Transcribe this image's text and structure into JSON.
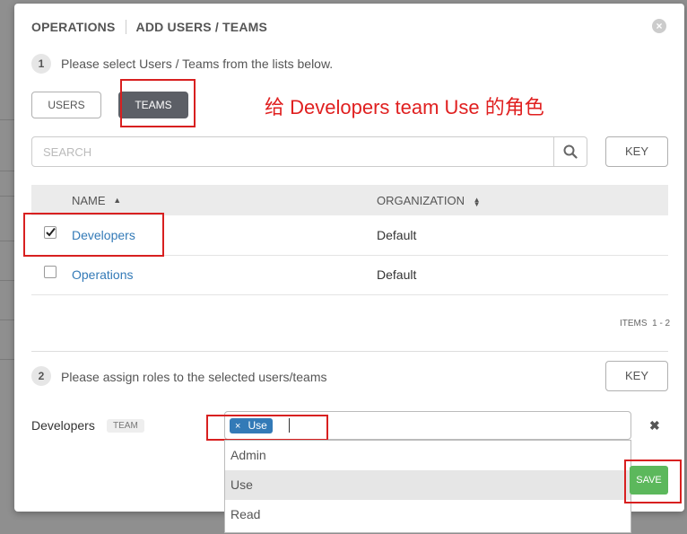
{
  "header": {
    "crumb1": "OPERATIONS",
    "crumb2": "ADD USERS / TEAMS",
    "close_icon": "close-circle-icon"
  },
  "step1": {
    "num": "1",
    "text": "Please select Users / Teams from the lists below."
  },
  "tabs": {
    "users": "USERS",
    "teams": "TEAMS",
    "active": "teams"
  },
  "annotation": "给 Developers team Use 的角色",
  "search": {
    "placeholder": "SEARCH",
    "key_label": "KEY",
    "icon": "search-icon"
  },
  "table": {
    "col_name": "NAME",
    "col_org": "ORGANIZATION",
    "rows": [
      {
        "name": "Developers",
        "org": "Default",
        "checked": true
      },
      {
        "name": "Operations",
        "org": "Default",
        "checked": false
      }
    ],
    "items_label": "ITEMS  1 - 2"
  },
  "step2": {
    "num": "2",
    "text": "Please assign roles to the selected users/teams",
    "key_label": "KEY"
  },
  "assign": {
    "entity": "Developers",
    "badge": "TEAM",
    "tag": "Use",
    "tag_remove": "×",
    "remove_icon": "✖",
    "options": [
      "Admin",
      "Use",
      "Read"
    ],
    "selected_option": "Use"
  },
  "save_label": "SAVE",
  "colors": {
    "accent": "#337ab7",
    "save": "#5cb85c",
    "annotation": "#e02020",
    "active_tab": "#5c5f66"
  }
}
